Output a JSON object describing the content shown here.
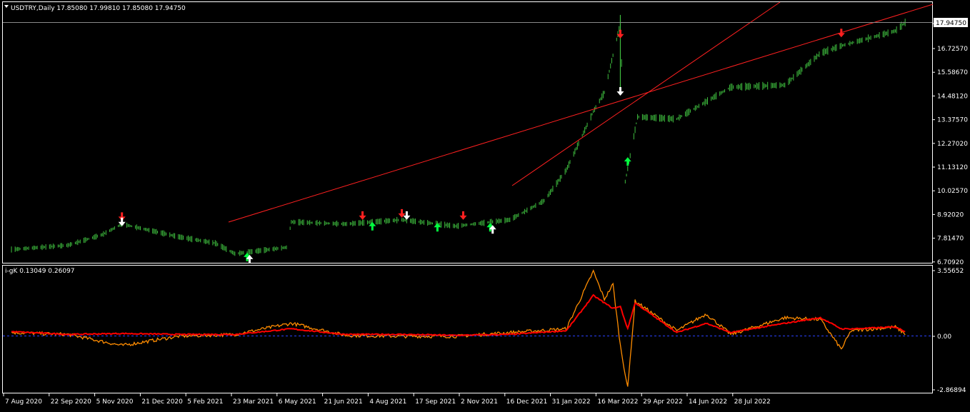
{
  "price_panel": {
    "header": "USDTRY,Daily  17.85080 17.99810 17.85080 17.94750",
    "current_price_label": "17.94750",
    "axis_labels": [
      "17.94750",
      "16.72570",
      "15.58670",
      "14.48120",
      "13.37570",
      "12.27020",
      "11.13120",
      "10.02570",
      "8.92020",
      "7.81470",
      "6.70920"
    ]
  },
  "indicator_panel": {
    "header": "i-gK 0.13049 0.26097",
    "axis_labels": [
      "3.55652",
      "0.00",
      "-2.86894"
    ]
  },
  "time_axis_labels": [
    "7 Aug 2020",
    "22 Sep 2020",
    "5 Nov 2020",
    "21 Dec 2020",
    "5 Feb 2021",
    "23 Mar 2021",
    "6 May 2021",
    "21 Jun 2021",
    "4 Aug 2021",
    "17 Sep 2021",
    "2 Nov 2021",
    "16 Dec 2021",
    "31 Jan 2022",
    "16 Mar 2022",
    "29 Apr 2022",
    "14 Jun 2022",
    "28 Jul 2022"
  ],
  "colors": {
    "background": "#000000",
    "frame": "#ffffff",
    "candles": "#3fbf3f",
    "trendline": "#ff2020",
    "igk_line_1": "#ff8c00",
    "igk_line_2": "#ff0000",
    "zero_line": "#2a40ff",
    "arrow_up": "#00ff40",
    "arrow_down": "#ff2020",
    "arrow_white": "#ffffff"
  },
  "chart_data": [
    {
      "type": "line",
      "title": "USDTRY,Daily",
      "xlabel": "",
      "ylabel": "",
      "x": [
        "2020-08-07",
        "2020-09-22",
        "2020-10-20",
        "2020-11-05",
        "2020-12-21",
        "2021-01-20",
        "2021-02-05",
        "2021-03-19",
        "2021-03-23",
        "2021-05-06",
        "2021-06-21",
        "2021-08-04",
        "2021-09-17",
        "2021-10-15",
        "2021-11-02",
        "2021-11-24",
        "2021-12-03",
        "2021-12-16",
        "2021-12-20",
        "2021-12-30",
        "2022-01-31",
        "2022-03-16",
        "2022-04-29",
        "2022-05-28",
        "2022-06-14",
        "2022-07-28",
        "2022-08-05"
      ],
      "series": [
        {
          "values": [
            7.25,
            7.45,
            7.95,
            8.45,
            7.85,
            7.55,
            7.05,
            7.35,
            8.55,
            8.45,
            8.65,
            8.35,
            8.65,
            9.55,
            11.0,
            13.75,
            14.65,
            17.9,
            10.45,
            13.5,
            13.4,
            14.9,
            15.0,
            16.5,
            16.85,
            17.55,
            17.95
          ]
        }
      ],
      "ylim": [
        6.7092,
        17.9475
      ],
      "grid": false
    },
    {
      "type": "line",
      "title": "i-gK",
      "xlabel": "",
      "ylabel": "",
      "x": [
        "2020-08-07",
        "2020-09-22",
        "2020-11-05",
        "2020-12-21",
        "2021-02-05",
        "2021-03-23",
        "2021-05-06",
        "2021-06-21",
        "2021-08-04",
        "2021-09-17",
        "2021-11-02",
        "2021-11-24",
        "2021-12-03",
        "2021-12-10",
        "2021-12-16",
        "2021-12-22",
        "2021-12-28",
        "2022-01-31",
        "2022-02-24",
        "2022-03-16",
        "2022-04-29",
        "2022-05-28",
        "2022-06-14",
        "2022-06-22",
        "2022-07-28",
        "2022-08-05"
      ],
      "series": [
        {
          "values": [
            0.2,
            0.1,
            -0.5,
            0.0,
            0.1,
            0.7,
            0.05,
            0.0,
            0.0,
            0.2,
            0.4,
            3.5,
            2.0,
            2.8,
            -0.5,
            -2.8,
            1.9,
            0.3,
            1.2,
            0.1,
            1.0,
            0.9,
            -0.7,
            0.3,
            0.5,
            0.13049
          ]
        },
        {
          "values": [
            0.25,
            0.1,
            0.15,
            0.1,
            0.1,
            0.4,
            0.1,
            0.1,
            0.05,
            0.1,
            0.3,
            2.2,
            1.8,
            1.5,
            1.6,
            0.4,
            1.8,
            0.2,
            0.7,
            0.2,
            0.7,
            1.0,
            0.4,
            0.4,
            0.5,
            0.26097
          ]
        }
      ],
      "ylim": [
        -2.86894,
        3.55652
      ],
      "grid": false
    }
  ]
}
